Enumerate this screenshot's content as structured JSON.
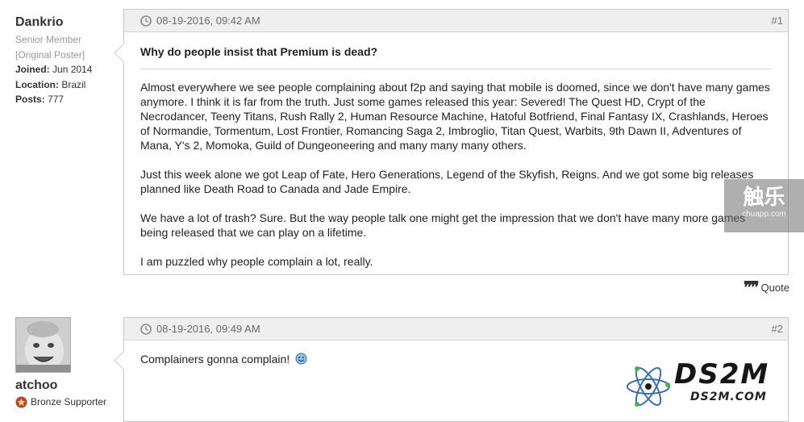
{
  "post1": {
    "user": {
      "username": "Dankrio",
      "rank": "Senior Member",
      "tag": "[Original Poster]",
      "joined_label": "Joined:",
      "joined_value": "Jun 2014",
      "location_label": "Location:",
      "location_value": "Brazil",
      "posts_label": "Posts:",
      "posts_value": "777"
    },
    "date": "08-19-2016, 09:42 AM",
    "number": "#1",
    "title": "Why do people insist that Premium is dead?",
    "paragraphs": [
      "Almost everywhere we see people complaining about f2p and saying that mobile is doomed, since we don't have many games anymore. I think it is far from the truth. Just some games released this year: Severed! The Quest HD, Crypt of the Necrodancer, Teeny Titans, Rush Rally 2, Human Resource Machine, Hatoful Botfriend, Final Fantasy IX, Crashlands, Heroes of Normandie, Tormentum, Lost Frontier, Romancing Saga 2, Imbroglio, Titan Quest, Warbits, 9th Dawn II, Adventures of Mana, Y's 2, Momoka, Guild of Dungeoneering and many many many others.",
      "Just this week alone we got Leap of Fate, Hero Generations, Legend of the Skyfish, Reigns. And we got some big releases planned like Death Road to Canada and Jade Empire.",
      "We have a lot of trash? Sure. But the way people talk one might get the impression that we don't have many more games being released that we can play on a lifetime.",
      "I am puzzled why people complain a lot, really."
    ],
    "quote_label": "Quote"
  },
  "post2": {
    "user": {
      "username": "atchoo",
      "rank": "Bronze Supporter"
    },
    "date": "08-19-2016, 09:49 AM",
    "number": "#2",
    "body": "Complainers gonna complain!"
  },
  "watermarks": {
    "chulue": {
      "big": "触乐",
      "small": "chuapp.com"
    },
    "ds2m": {
      "big": "DS2M",
      "small": "DS2M.COM"
    }
  },
  "colors": {
    "header_bg": "#efefef",
    "border": "#c8c8c8",
    "muted_text": "#999999",
    "badge": "#b5452b"
  },
  "icons": [
    "clock-icon",
    "quote-icon",
    "smiley-icon",
    "bronze-badge-icon",
    "avatar"
  ]
}
